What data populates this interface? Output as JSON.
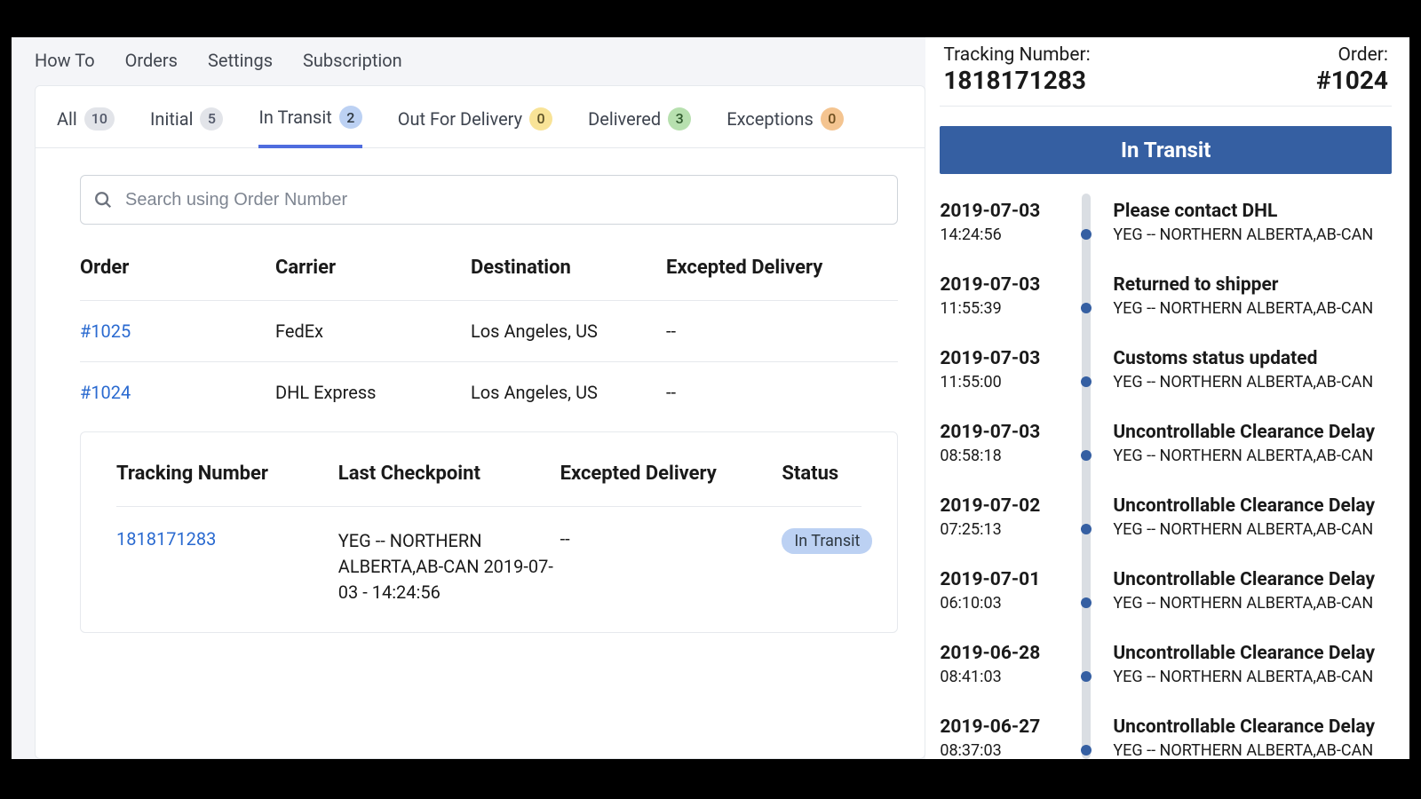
{
  "nav": {
    "howto": "How To",
    "orders": "Orders",
    "settings": "Settings",
    "subscription": "Subscription"
  },
  "tabs": [
    {
      "label": "All",
      "count": "10",
      "pill": "pill-grey",
      "active": false
    },
    {
      "label": "Initial",
      "count": "5",
      "pill": "pill-grey",
      "active": false
    },
    {
      "label": "In Transit",
      "count": "2",
      "pill": "pill-blue",
      "active": true
    },
    {
      "label": "Out For Delivery",
      "count": "0",
      "pill": "pill-yellow",
      "active": false
    },
    {
      "label": "Delivered",
      "count": "3",
      "pill": "pill-green",
      "active": false
    },
    {
      "label": "Exceptions",
      "count": "0",
      "pill": "pill-orange",
      "active": false
    }
  ],
  "search": {
    "placeholder": "Search using Order Number"
  },
  "orders_table": {
    "headers": {
      "order": "Order",
      "carrier": "Carrier",
      "destination": "Destination",
      "expected": "Excepted Delivery"
    },
    "rows": [
      {
        "order": "#1025",
        "carrier": "FedEx",
        "destination": "Los Angeles, US",
        "expected": "--"
      },
      {
        "order": "#1024",
        "carrier": "DHL Express",
        "destination": "Los Angeles, US",
        "expected": "--"
      }
    ]
  },
  "tracking_table": {
    "headers": {
      "tn": "Tracking Number",
      "lc": "Last Checkpoint",
      "ed": "Excepted Delivery",
      "st": "Status"
    },
    "row": {
      "tn": "1818171283",
      "lc": "YEG -- NORTHERN ALBERTA,AB-CAN 2019-07-03 - 14:24:56",
      "ed": "--",
      "st": "In Transit"
    }
  },
  "detail": {
    "tn_label": "Tracking Number:",
    "tn_value": "1818171283",
    "order_label": "Order:",
    "order_value": "#1024",
    "status": "In Transit",
    "events": [
      {
        "date": "2019-07-03",
        "time": "14:24:56",
        "title": "Please contact DHL",
        "loc": "YEG -- NORTHERN ALBERTA,AB-CAN"
      },
      {
        "date": "2019-07-03",
        "time": "11:55:39",
        "title": "Returned to shipper",
        "loc": "YEG -- NORTHERN ALBERTA,AB-CAN"
      },
      {
        "date": "2019-07-03",
        "time": "11:55:00",
        "title": "Customs status updated",
        "loc": "YEG -- NORTHERN ALBERTA,AB-CAN"
      },
      {
        "date": "2019-07-03",
        "time": "08:58:18",
        "title": "Uncontrollable Clearance Delay",
        "loc": "YEG -- NORTHERN ALBERTA,AB-CAN"
      },
      {
        "date": "2019-07-02",
        "time": "07:25:13",
        "title": "Uncontrollable Clearance Delay",
        "loc": "YEG -- NORTHERN ALBERTA,AB-CAN"
      },
      {
        "date": "2019-07-01",
        "time": "06:10:03",
        "title": "Uncontrollable Clearance Delay",
        "loc": "YEG -- NORTHERN ALBERTA,AB-CAN"
      },
      {
        "date": "2019-06-28",
        "time": "08:41:03",
        "title": "Uncontrollable Clearance Delay",
        "loc": "YEG -- NORTHERN ALBERTA,AB-CAN"
      },
      {
        "date": "2019-06-27",
        "time": "08:37:03",
        "title": "Uncontrollable Clearance Delay",
        "loc": "YEG -- NORTHERN ALBERTA,AB-CAN"
      }
    ]
  }
}
